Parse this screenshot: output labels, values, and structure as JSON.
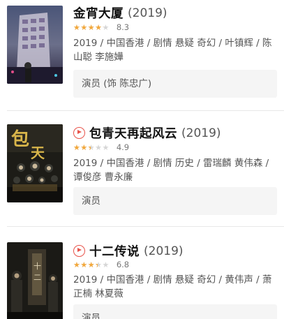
{
  "movies": [
    {
      "title": "金宵大厦",
      "year": "(2019)",
      "has_play": false,
      "rating_fraction": 0.83,
      "score": "8.3",
      "meta": "2019 / 中国香港 / 剧情 悬疑 奇幻 / 叶镇辉 / 陈山聪 李施嬅",
      "actor_role": "演员 (饰 陈忠广)"
    },
    {
      "title": "包青天再起风云",
      "year": "(2019)",
      "has_play": true,
      "rating_fraction": 0.49,
      "score": "4.9",
      "meta": "2019 / 中国香港 / 剧情 历史 / 雷瑞麟 黄伟森 / 谭俊彦 曹永廉",
      "actor_role": "演员"
    },
    {
      "title": "十二传说",
      "year": "(2019)",
      "has_play": true,
      "rating_fraction": 0.68,
      "score": "6.8",
      "meta": "2019 / 中国香港 / 剧情 悬疑 奇幻 / 黄伟声 / 萧正楠 林夏薇",
      "actor_role": "演员"
    }
  ],
  "icons": {
    "star": "star-icon",
    "play": "play-circle-icon"
  },
  "colors": {
    "star": "#f3a83b",
    "play": "#e8534a",
    "actor_box_bg": "#f5f5f5"
  }
}
